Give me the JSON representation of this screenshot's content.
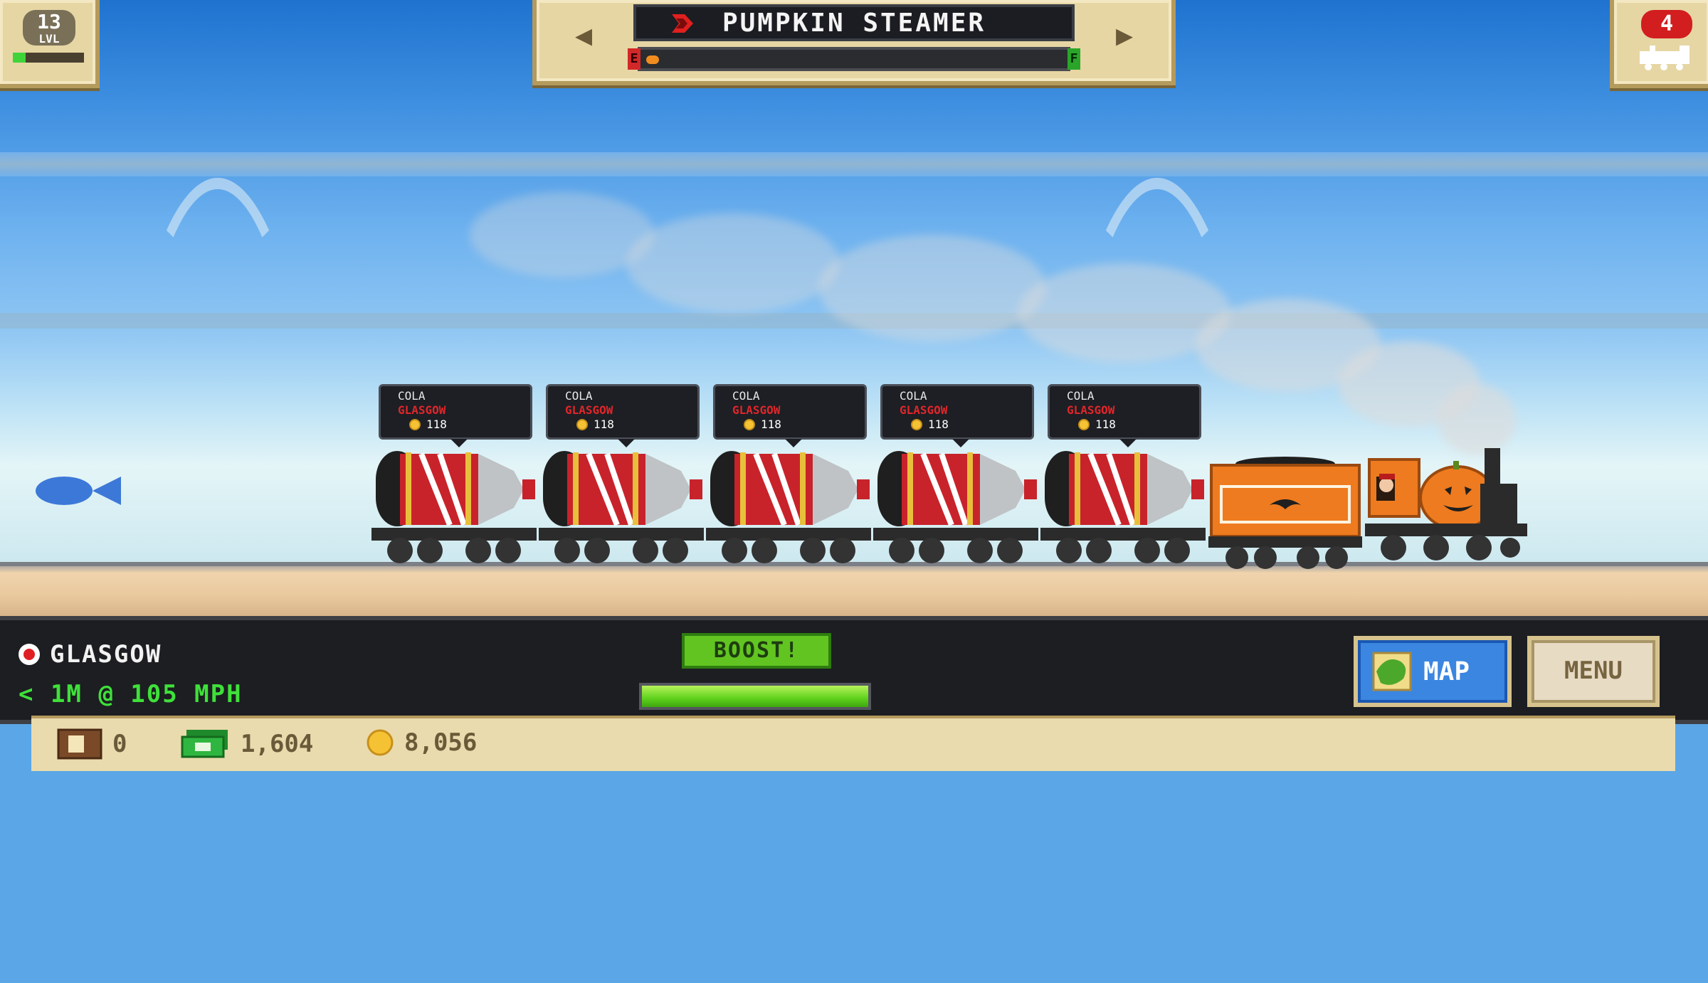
{
  "hud_top": {
    "level": "13",
    "level_label": "LVL",
    "level_progress": 0.18,
    "train_name": "PUMPKIN STEAMER",
    "fuel_empty_label": "E",
    "fuel_full_label": "F",
    "fuel_level": 0.03,
    "trains_count": "4",
    "prev_arrow": "◀",
    "next_arrow": "▶"
  },
  "cars": [
    {
      "cargo": "COLA",
      "destination": "GLASGOW",
      "payout": "118"
    },
    {
      "cargo": "COLA",
      "destination": "GLASGOW",
      "payout": "118"
    },
    {
      "cargo": "COLA",
      "destination": "GLASGOW",
      "payout": "118"
    },
    {
      "cargo": "COLA",
      "destination": "GLASGOW",
      "payout": "118"
    },
    {
      "cargo": "COLA",
      "destination": "GLASGOW",
      "payout": "118"
    }
  ],
  "hud_bottom": {
    "station": "GLASGOW",
    "speed": "< 1M @ 105 MPH",
    "boost_label": "BOOST!",
    "boost_level": 1.0,
    "map_label": "MAP",
    "menu_label": "MENU"
  },
  "resources": {
    "crates": "0",
    "cash": "1,604",
    "coins": "8,056"
  },
  "colors": {
    "cola_red": "#c8232b",
    "locomotive_orange": "#ee7b1f",
    "boost_green": "#62c421",
    "map_blue": "#3b86e0"
  }
}
